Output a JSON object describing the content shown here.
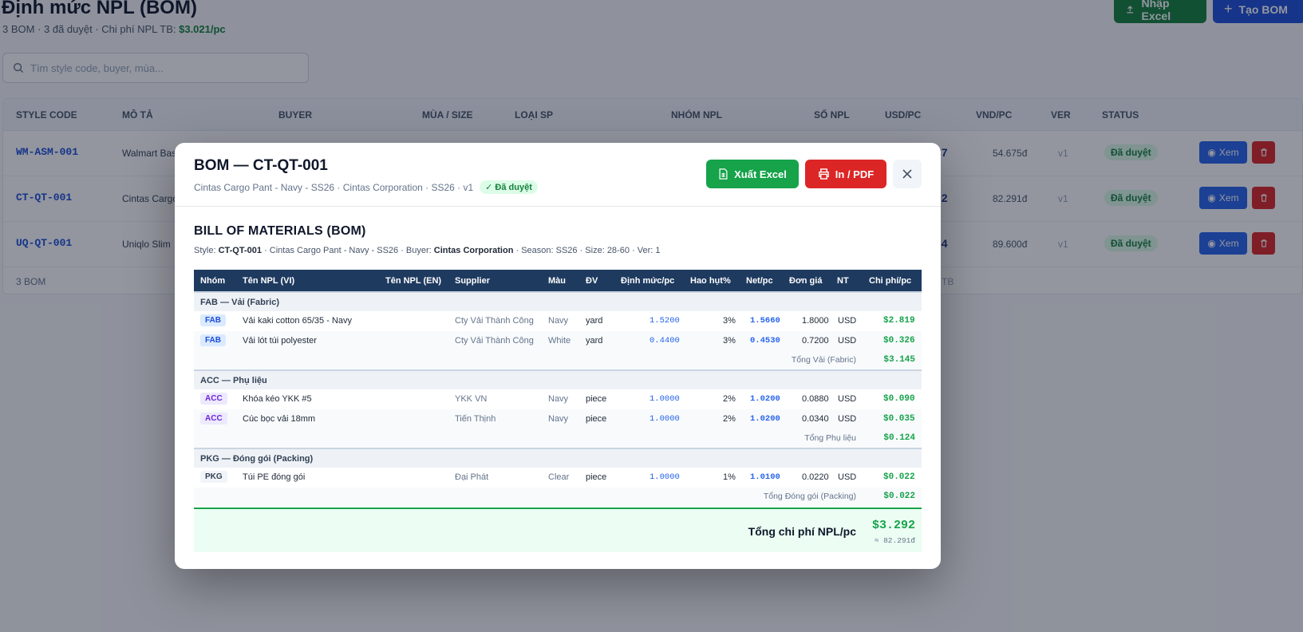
{
  "page": {
    "title": "Định mức NPL (BOM)",
    "subtitle_prefix": "3 BOM · 3 đã duyệt · Chi phí NPL TB: ",
    "avg_cost": "$3.021/pc",
    "import_label": "Nhập Excel",
    "create_label": "Tạo BOM",
    "search_placeholder": "Tìm style code, buyer, mùa..."
  },
  "list": {
    "headers": [
      "STYLE CODE",
      "MÔ TẢ",
      "BUYER",
      "MÙA / SIZE",
      "LOẠI SP",
      "NHÓM NPL",
      "SỐ NPL",
      "USD/PC",
      "VND/PC",
      "VER",
      "STATUS"
    ],
    "rows": [
      {
        "code": "WM-ASM-001",
        "desc": "Walmart Bas",
        "usd": "37",
        "vnd": "54.675đ",
        "ver": "v1",
        "status": "Đã duyệt"
      },
      {
        "code": "CT-QT-001",
        "desc": "Cintas Cargo",
        "usd": "92",
        "vnd": "82.291đ",
        "ver": "v1",
        "status": "Đã duyệt"
      },
      {
        "code": "UQ-QT-001",
        "desc": "Uniqlo Slim",
        "usd": "34",
        "vnd": "89.600đ",
        "ver": "v1",
        "status": "Đã duyệt"
      }
    ],
    "view_label": "Xem",
    "footer": "3 BOM",
    "footer_right": "TB"
  },
  "modal": {
    "title": "BOM — CT-QT-001",
    "subtitle": "Cintas Cargo Pant - Navy - SS26 · Cintas Corporation · SS26 · v1",
    "status": "✓ Đã duyệt",
    "excel_label": "Xuất Excel",
    "pdf_label": "In / PDF",
    "bom_title": "BILL OF MATERIALS (BOM)",
    "meta": {
      "style_label": "Style: ",
      "style": "CT-QT-001",
      "desc": " · Cintas Cargo Pant - Navy - SS26 · Buyer: ",
      "buyer": "Cintas Corporation",
      "rest": " · Season: SS26 · Size: 28-60 · Ver: 1"
    },
    "columns": [
      "Nhóm",
      "Tên NPL (VI)",
      "Tên NPL (EN)",
      "Supplier",
      "Màu",
      "ĐV",
      "Định mức/pc",
      "Hao hụt%",
      "Net/pc",
      "Đơn giá",
      "NT",
      "Chi phí/pc"
    ],
    "groups": [
      {
        "name": "FAB — Vải (Fabric)",
        "code": "FAB",
        "items": [
          {
            "name": "Vải kaki cotton 65/35 - Navy",
            "en": "",
            "supplier": "Cty Vải Thành Công",
            "color": "Navy",
            "unit": "yard",
            "qty": "1.5200",
            "waste": "3%",
            "net": "1.5660",
            "price": "1.8000",
            "cur": "USD",
            "cost": "$2.819"
          },
          {
            "name": "Vải lót túi polyester",
            "en": "",
            "supplier": "Cty Vải Thành Công",
            "color": "White",
            "unit": "yard",
            "qty": "0.4400",
            "waste": "3%",
            "net": "0.4530",
            "price": "0.7200",
            "cur": "USD",
            "cost": "$0.326"
          }
        ],
        "subtotal_label": "Tổng Vải (Fabric)",
        "subtotal": "$3.145"
      },
      {
        "name": "ACC — Phụ liệu",
        "code": "ACC",
        "items": [
          {
            "name": "Khóa kéo YKK #5",
            "en": "",
            "supplier": "YKK VN",
            "color": "Navy",
            "unit": "piece",
            "qty": "1.0000",
            "waste": "2%",
            "net": "1.0200",
            "price": "0.0880",
            "cur": "USD",
            "cost": "$0.090"
          },
          {
            "name": "Cúc bọc vải 18mm",
            "en": "",
            "supplier": "Tiến Thịnh",
            "color": "Navy",
            "unit": "piece",
            "qty": "1.0000",
            "waste": "2%",
            "net": "1.0200",
            "price": "0.0340",
            "cur": "USD",
            "cost": "$0.035"
          }
        ],
        "subtotal_label": "Tổng Phụ liệu",
        "subtotal": "$0.124"
      },
      {
        "name": "PKG — Đóng gói (Packing)",
        "code": "PKG",
        "items": [
          {
            "name": "Túi PE đóng gói",
            "en": "",
            "supplier": "Đại Phát",
            "color": "Clear",
            "unit": "piece",
            "qty": "1.0000",
            "waste": "1%",
            "net": "1.0100",
            "price": "0.0220",
            "cur": "USD",
            "cost": "$0.022"
          }
        ],
        "subtotal_label": "Tổng Đóng gói (Packing)",
        "subtotal": "$0.022"
      }
    ],
    "total_label": "Tổng chi phí NPL/pc",
    "total": "$3.292",
    "total_vnd": "≈ 82.291đ"
  }
}
